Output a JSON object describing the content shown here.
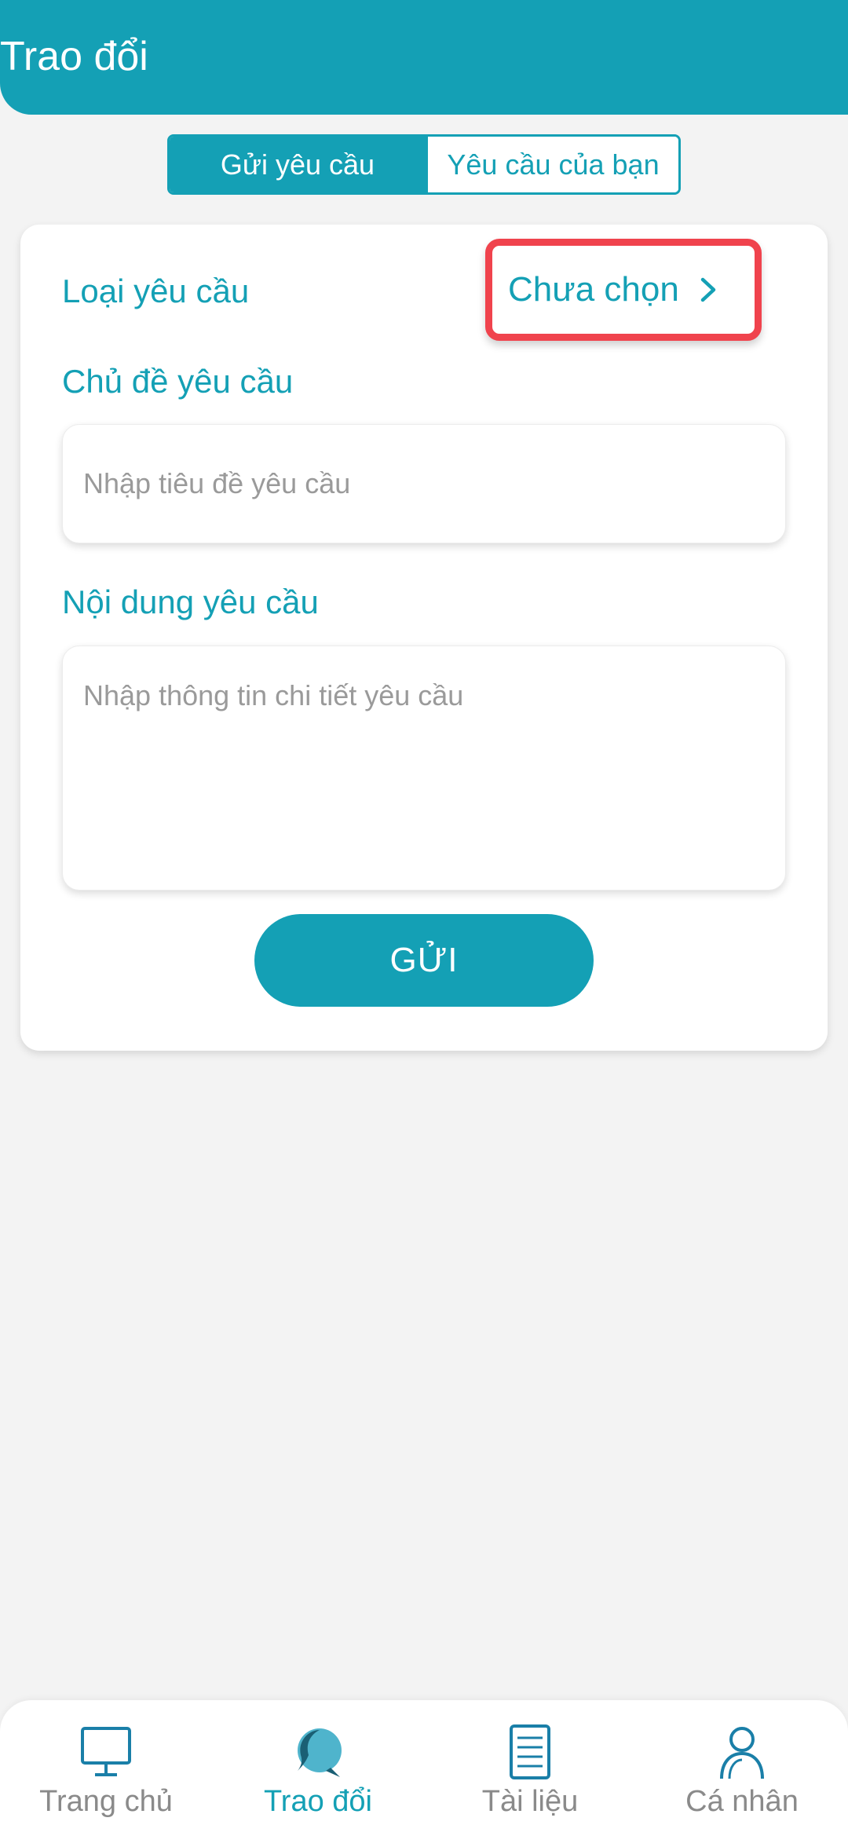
{
  "header": {
    "title": "Trao đổi"
  },
  "segments": {
    "send_label": "Gửi yêu cầu",
    "mine_label": "Yêu cầu của bạn"
  },
  "form": {
    "type_label": "Loại yêu cầu",
    "type_value": "Chưa chọn",
    "subject_label": "Chủ đề yêu cầu",
    "subject_placeholder": "Nhập tiêu đề yêu cầu",
    "content_label": "Nội dung yêu cầu",
    "content_placeholder": "Nhập thông tin chi tiết yêu cầu",
    "submit_label": "GỬI"
  },
  "nav": {
    "items": [
      {
        "label": "Trang chủ",
        "icon": "monitor-icon",
        "active": false
      },
      {
        "label": "Trao đổi",
        "icon": "chat-bubble-icon",
        "active": true
      },
      {
        "label": "Tài liệu",
        "icon": "document-icon",
        "active": false
      },
      {
        "label": "Cá nhân",
        "icon": "person-icon",
        "active": false
      }
    ]
  },
  "colors": {
    "accent": "#14a0b5",
    "highlight": "#f0434d",
    "background": "#f3f3f3"
  }
}
